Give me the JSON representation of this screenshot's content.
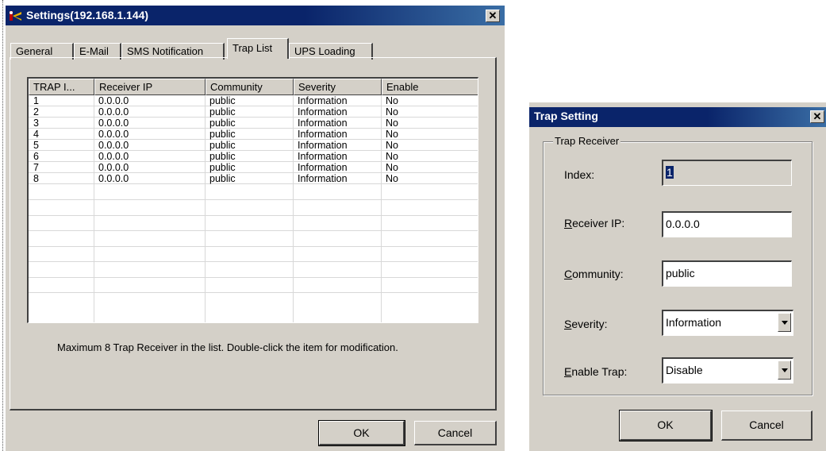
{
  "settings_window": {
    "title": "Settings(192.168.1.144)",
    "close_glyph": "✕",
    "tabs": [
      {
        "label": "General"
      },
      {
        "label": "E-Mail"
      },
      {
        "label": "SMS Notification"
      },
      {
        "label": "Trap List"
      },
      {
        "label": "UPS Loading"
      }
    ],
    "active_tab": "Trap List",
    "table": {
      "columns": [
        "TRAP I...",
        "Receiver IP",
        "Community",
        "Severity",
        "Enable"
      ],
      "rows": [
        [
          "1",
          "0.0.0.0",
          "public",
          "Information",
          "No"
        ],
        [
          "2",
          "0.0.0.0",
          "public",
          "Information",
          "No"
        ],
        [
          "3",
          "0.0.0.0",
          "public",
          "Information",
          "No"
        ],
        [
          "4",
          "0.0.0.0",
          "public",
          "Information",
          "No"
        ],
        [
          "5",
          "0.0.0.0",
          "public",
          "Information",
          "No"
        ],
        [
          "6",
          "0.0.0.0",
          "public",
          "Information",
          "No"
        ],
        [
          "7",
          "0.0.0.0",
          "public",
          "Information",
          "No"
        ],
        [
          "8",
          "0.0.0.0",
          "public",
          "Information",
          "No"
        ]
      ]
    },
    "note": "Maximum 8 Trap Receiver in the list. Double-click the item for modification.",
    "ok_label": "OK",
    "cancel_label": "Cancel"
  },
  "trap_dialog": {
    "title": "Trap Setting",
    "close_glyph": "✕",
    "group_label": "Trap Receiver",
    "index_label": "Index:",
    "index_value": "1",
    "receiver_ip_label": {
      "mnemonic": "R",
      "rest": "eceiver IP:"
    },
    "receiver_ip_value": "0.0.0.0",
    "community_label": {
      "mnemonic": "C",
      "rest": "ommunity:"
    },
    "community_value": "public",
    "severity_label": {
      "mnemonic": "S",
      "rest": "everity:"
    },
    "severity_value": "Information",
    "enable_label": {
      "mnemonic": "E",
      "rest": "nable Trap:"
    },
    "enable_value": "Disable",
    "ok_label": "OK",
    "cancel_label": "Cancel"
  },
  "colors": {
    "titlebar": "#0a246a",
    "face": "#d4d0c8"
  }
}
